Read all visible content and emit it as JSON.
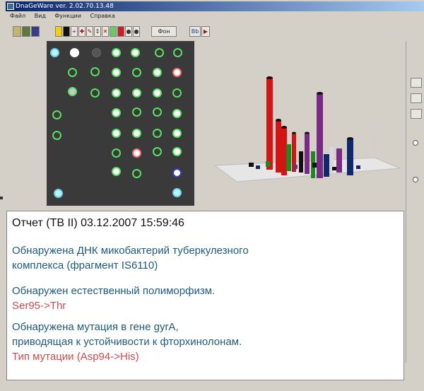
{
  "window": {
    "title": "DnaGeWare ver. 2.02.70.13.48"
  },
  "menu": [
    "Файл",
    "Вид",
    "Функции",
    "Справка"
  ],
  "toolbar": {
    "report_label": "Фон",
    "letter_label": "Bb"
  },
  "report": {
    "title": "Отчет (ТВ II) 03.12.2007 15:59:46",
    "line1": "Обнаружена ДНК микобактерий туберкулезного",
    "line2": "комплекса (фрагмент IS6110)",
    "line3": "Обнаружен естественный полиморфизм.",
    "line4": "Ser95->Thr",
    "line5": "Обнаружена мутация в гене gyrA,",
    "line6": "приводящая к  устойчивости к фторхинолонам.",
    "line7": "Тип мутации (Asp94->His)"
  },
  "colors": {
    "text_blue": "#1d5b86",
    "text_red": "#d94a4a",
    "titlebar": "#0a246a"
  }
}
